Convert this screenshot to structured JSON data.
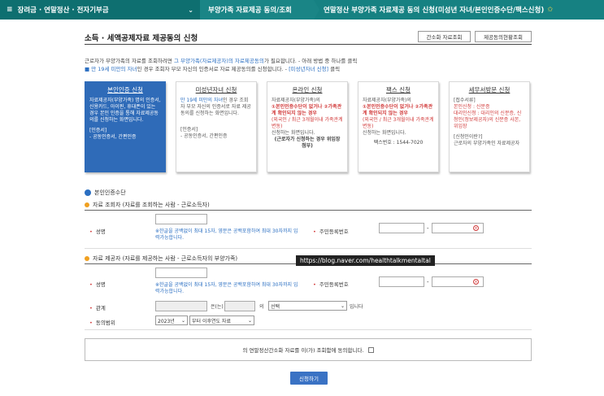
{
  "topbar": {
    "menu_icon": "≡",
    "menu": "장려금 · 연말정산 · 전자기부금",
    "step1": "부양가족 자료제공 동의/조회",
    "step2": "연말정산 부양가족 자료제공 동의 신청(미성년 자녀/본인인증수단/팩스신청)",
    "star": "✩"
  },
  "page": {
    "title": "소득 · 세액공제자료 제공동의 신청",
    "btn_simple": "간소화 자료조회",
    "btn_status": "제공동의현황조회",
    "intro1_a": "근로자가 부양가족의 자료를 조회하려면 ",
    "intro1_b": "그 부양가족(자료제공자)의 자료제공동의",
    "intro1_c": "가 필요합니다. - 아래 방법 중 하나를 클릭",
    "intro2_a": "■ 만 19세 미만의 자녀",
    "intro2_b": "인 경우 조회자 부모 자신의 인증서로 자료 제공동의를 신청합니다. - ",
    "intro2_c": "[미성년자녀 신청]",
    "intro2_d": " 클릭"
  },
  "cards": [
    {
      "title": "본인인증 신청",
      "body": "자료제공자(부양가족) 명의 인증서, 신용카드, 아이핀, 휴대폰이 있는 경우 본인 인증을 통해 자료제공동의를 신청하는 화면입니다.",
      "sub1": "[인증서]",
      "sub2": "- 공동인증서, 간편인증"
    },
    {
      "title": "미성년자녀 신청",
      "body_a": "만 19세 미만의 자녀",
      "body_b": "인 경우 조회자 부모 자신의 인증서로 자료 제공 동의를 신청하는 화면입니다.",
      "sub1": "[인증서]",
      "sub2": "- 공동인증서, 간편인증"
    },
    {
      "title": "온라인 신청",
      "body_a": "자료제공자(부양가족)의",
      "body_b": "①본인인증수단이 없거나 ②가족관계 확인되지 않는 경우",
      "body_c": "(외국인 / 최근 3개월이내 가족관계 변동)",
      "body_d": "신청하는 화면입니다.",
      "sub1": "(근로자가 신청하는 경우 위임장 첨부)"
    },
    {
      "title": "팩스 신청",
      "body_a": "자료제공자(부양가족)의",
      "body_b": "①본인인증수단이 없거나 ②가족관계 확인되지 않는 경우",
      "body_c": "(외국인 / 최근 3개월이내 가족관계 변동)",
      "body_d": "신청하는 화면입니다.",
      "sub1": "팩스번호 : 1544-7020"
    },
    {
      "title": "세무서방문 신청",
      "body_a": "[접수서류]",
      "body_b": "본인신청 : 신분증",
      "body_c": "대리인신청 : 대리인의 신분증, 신청인(정보제공자)의 신분증 사본, 위임장",
      "sub1": "[신청인이란?]",
      "sub2": "근로자의 부양가족인 자료제공자"
    }
  ],
  "section": {
    "title": "본인인증수단",
    "viewer_head": "자료 조회자 (자료를 조회하는 사람 - 근로소득자)",
    "provider_head": "자료 제공자 (자료를 제공하는 사람 - 근로소득자의 부양가족)",
    "name_label": "성명",
    "rrn_label": "주민등록번호",
    "name_hint": "※한글을 공백없이 최대 15자, 영문은 공백포함하여 최대 30자까지 입력가능합니다.",
    "dash": "-",
    "relation_label": "관계",
    "relation_eun": "은(는)",
    "relation_ui": "의",
    "relation_select": "선택",
    "relation_end": "입니다",
    "consent_label": "동의범위",
    "year_select": "2023년",
    "range_from": "부터",
    "range_select": "부터 이후연도 자료"
  },
  "tooltip_url": "https://blog.naver.com/healthtalkmentaltal",
  "consent_text": "의 연말정산간소화 자료를 이(가) 조회함에 동의합니다.",
  "apply_label": "신청하기",
  "colors": {
    "teal": "#137b7c",
    "blue": "#2f6bb8",
    "required": "#d23c3c",
    "bullet": "#f0a020"
  }
}
